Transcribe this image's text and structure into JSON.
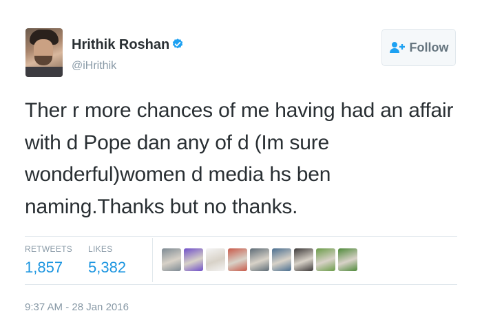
{
  "user": {
    "name": "Hrithik Roshan",
    "handle": "@iHrithik",
    "verified": true,
    "verified_color": "#1da1f2"
  },
  "follow_button": {
    "label": "Follow",
    "icon": "add-user-icon"
  },
  "tweet": {
    "lines": [
      "Ther r more chances of me having had an affair",
      "with d Pope dan any of d (Im sure",
      "wonderful)women d media hs ben",
      "naming.Thanks but no thanks."
    ]
  },
  "stats": {
    "retweets_label": "RETWEETS",
    "retweets_count": "1,857",
    "likes_label": "LIKES",
    "likes_count": "5,382",
    "count_color": "#1b95e0"
  },
  "likers": [
    {
      "avatar": "person-photo",
      "color": "#7d8a93"
    },
    {
      "avatar": "colorful-dots",
      "color": "#6f4fc9"
    },
    {
      "avatar": "small-figure",
      "color": "#f4f4f4"
    },
    {
      "avatar": "person-photo",
      "color": "#c85a4a"
    },
    {
      "avatar": "person-photo",
      "color": "#5e6c77"
    },
    {
      "avatar": "person-photo",
      "color": "#4a6e90"
    },
    {
      "avatar": "person-photo",
      "color": "#3d3a3a"
    },
    {
      "avatar": "landscape-photo",
      "color": "#6a9c48"
    },
    {
      "avatar": "plant-photo",
      "color": "#4f8a3a"
    }
  ],
  "timestamp": "9:37 AM - 28 Jan 2016"
}
